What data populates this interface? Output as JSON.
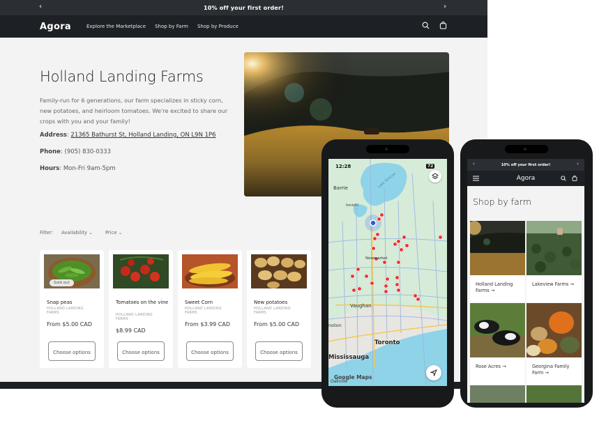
{
  "desktop": {
    "announcement": "10% off your first order!",
    "nav": {
      "logo": "Agora",
      "links": [
        "Explore the Marketplace",
        "Shop by Farm",
        "Shop by Produce"
      ]
    },
    "farm": {
      "title": "Holland Landing Farms",
      "description": "Family-run for 6 generations, our farm specializes in sticky corn, new potatoes, and heirloom tomatoes. We're excited to share our crops with you and your family!",
      "address_label": "Address",
      "address": "21365 Bathurst St, Holland Landing, ON L9N 1P6",
      "phone_label": "Phone",
      "phone": "(905) 830-0333",
      "hours_label": "Hours",
      "hours": "Mon-Fri 9am-5pm"
    },
    "filters": {
      "label": "Filter:",
      "availability": "Availability",
      "price": "Price"
    },
    "products": [
      {
        "name": "Snap peas",
        "vendor": "HOLLAND LANDING FARMS",
        "price": "From $5.00 CAD",
        "button": "Choose options",
        "badge": "Sold out"
      },
      {
        "name": "Tomatoes on the vine",
        "vendor": "HOLLAND LANDING FARMS",
        "price": "$8.99 CAD",
        "button": "Choose options"
      },
      {
        "name": "Sweet Corn",
        "vendor": "HOLLAND LANDING FARMS",
        "price": "From $3.99 CAD",
        "button": "Choose options"
      },
      {
        "name": "New potatoes",
        "vendor": "HOLLAND LANDING FARMS",
        "price": "From $5.00 CAD",
        "button": "Choose options"
      }
    ]
  },
  "map_phone": {
    "time": "12:28",
    "battery": "72",
    "places": {
      "barrie": "Barrie",
      "innisfil": "Innisfil",
      "lake": "Lake Simcoe",
      "newmarket": "Newmarket",
      "vaughan": "Vaughan",
      "toronto": "Toronto",
      "brampton": "noton",
      "mississauga": "Mississauga",
      "oakville": "Oakville"
    },
    "attribution": "Google Maps"
  },
  "shop_phone": {
    "announcement": "10% off your first order!",
    "logo": "Agora",
    "title": "Shop by farm",
    "farms": [
      {
        "label": "Holland Landing Farms →"
      },
      {
        "label": "Lakeview Farms →"
      },
      {
        "label": "Rose Acres →"
      },
      {
        "label": "Georgina Family Farm →"
      }
    ]
  },
  "colors": {
    "nav_dark": "#1d2024",
    "announce_bar": "#2b2e33",
    "page_bg": "#f3f3f3",
    "map_land": "#d6ecd9",
    "map_water": "#8fd3e8",
    "pin_red": "#e53935"
  }
}
